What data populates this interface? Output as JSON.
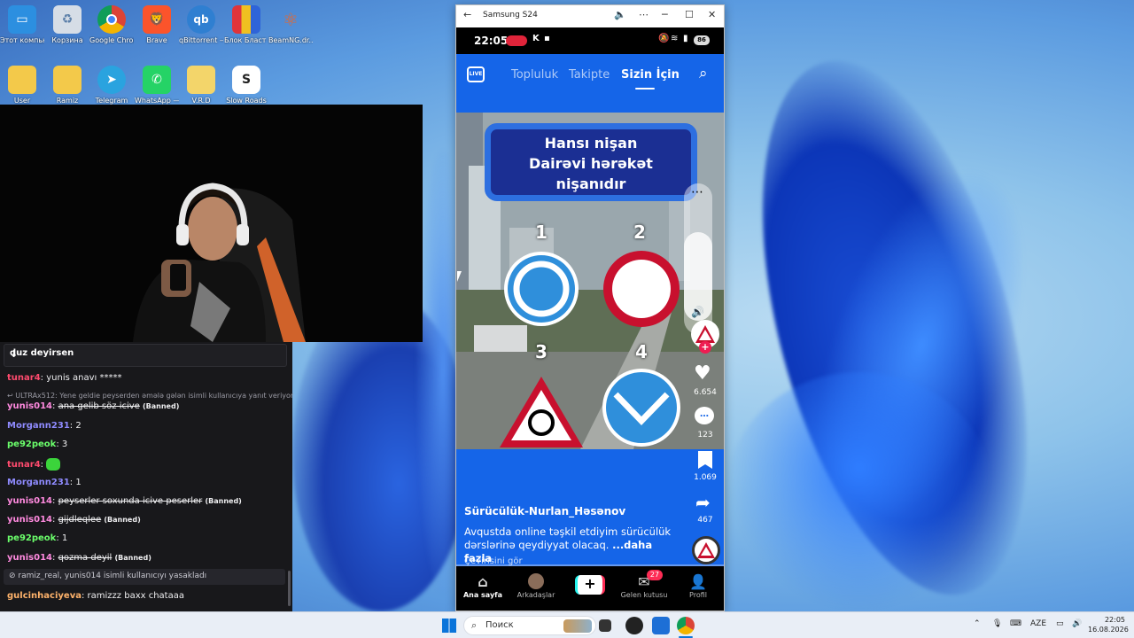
{
  "desktop": {
    "icons": [
      {
        "label": "Этот компьютер"
      },
      {
        "label": "Корзина"
      },
      {
        "label": "Google Chrome"
      },
      {
        "label": "Brave"
      },
      {
        "label": "qBittorrent — ярлык"
      },
      {
        "label": "Блок Бласт (Block Blast)"
      },
      {
        "label": "BeamNG.dr..."
      },
      {
        "label": "User"
      },
      {
        "label": "Ramiz"
      },
      {
        "label": "Telegram"
      },
      {
        "label": "WhatsApp —"
      },
      {
        "label": "V.R.D"
      },
      {
        "label": "Slow Roads"
      }
    ]
  },
  "chat": {
    "pinned": "duz deyirsen",
    "messages": [
      {
        "user": "tunar4",
        "text": "yunis anavı *****",
        "color": "#ff4b6e"
      },
      {
        "reply_note": "ULTRAx512: Yene geldie peyserden əmələ gələn isimli kullanıcıya yanıt veriyor"
      },
      {
        "user": "yunis014",
        "text": "ana gelib söz icive",
        "banned": "(Banned)",
        "color": "#ff8adf"
      },
      {
        "user": "Morgann231",
        "text": "2",
        "color": "#8f8bff"
      },
      {
        "user": "pe92peok",
        "text": "3",
        "color": "#6bff6b"
      },
      {
        "user": "tunar4",
        "text": "",
        "color": "#ff4b6e"
      },
      {
        "user": "Morgann231",
        "text": "1",
        "color": "#8f8bff"
      },
      {
        "user": "yunis014",
        "text": "peyserler soxunda icive peserler",
        "banned": "(Banned)",
        "color": "#ff8adf"
      },
      {
        "user": "yunis014",
        "text": "gijdleqlee",
        "banned": "(Banned)",
        "color": "#ff8adf"
      },
      {
        "user": "pe92peok",
        "text": "1",
        "color": "#6bff6b"
      },
      {
        "user": "yunis014",
        "text": "qozma deyil",
        "banned": "(Banned)",
        "color": "#ff8adf"
      },
      {
        "modnote": "ramiz_real, yunis014 isimli kullanıcıyı yasakladı"
      },
      {
        "user": "gulcinhaciyeva",
        "text": "ramizzz baxx chataaa",
        "color": "#ffb36b"
      }
    ]
  },
  "phone_window": {
    "title": "Samsung S24",
    "status": {
      "time": "22:05",
      "battery": "86"
    },
    "tabs": [
      "Topluluk",
      "Takipte",
      "Sizin İçin"
    ],
    "active_tab": "Sizin İçin",
    "video": {
      "question": [
        "Hansı nişan",
        "Dairəvi hərəkət",
        "nişanıdır"
      ],
      "numbers": [
        "1",
        "2",
        "3",
        "4"
      ]
    },
    "side": {
      "likes": "6.654",
      "comments": "123",
      "saves": "1.069",
      "shares": "467"
    },
    "caption": {
      "user": "Sürücülük-Nurlan_Həsənov",
      "text": "Avqustda online təşkil etdiyim sürücülük dərslərinə qeydiyyat olacaq.",
      "more": "...daha fazla",
      "translate": "Çevirisini gör"
    },
    "bottom_nav": [
      {
        "label": "Ana sayfa",
        "icon": "home-icon"
      },
      {
        "label": "Arkadaşlar",
        "icon": "friends-icon"
      },
      {
        "label": "",
        "icon": "plus-icon"
      },
      {
        "label": "Gelen kutusu",
        "icon": "inbox-icon",
        "badge": "27"
      },
      {
        "label": "Profil",
        "icon": "profile-icon"
      }
    ]
  },
  "taskbar": {
    "search_placeholder": "Поиск",
    "lang": "AZE",
    "time": "22:05",
    "date": "16.08.2026"
  }
}
